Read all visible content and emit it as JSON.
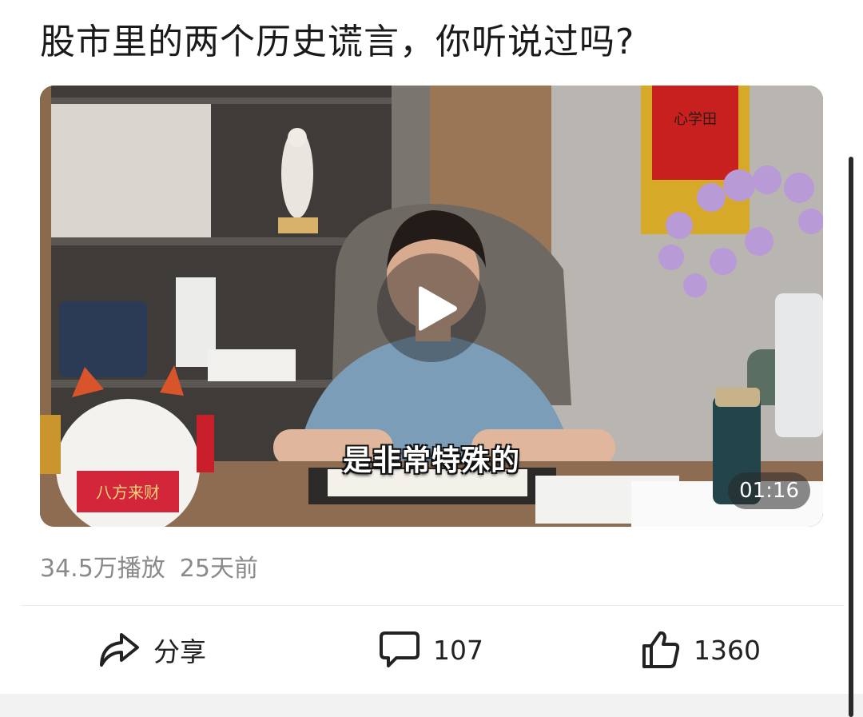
{
  "post": {
    "title": "股市里的两个历史谎言，你听说过吗?"
  },
  "video": {
    "subtitle": "是非常特殊的",
    "duration": "01:16",
    "calligraphy_text": "心学田",
    "cat_banner_text": "八方来财",
    "play_icon": "play-icon"
  },
  "meta": {
    "plays": "34.5万播放",
    "time_ago": "25天前"
  },
  "actions": {
    "share_label": "分享",
    "comment_count": "107",
    "like_count": "1360"
  },
  "colors": {
    "title": "#1a1a1a",
    "meta": "#8a8a8a",
    "action_text": "#222222",
    "footer_band": "#f2f2f2"
  }
}
